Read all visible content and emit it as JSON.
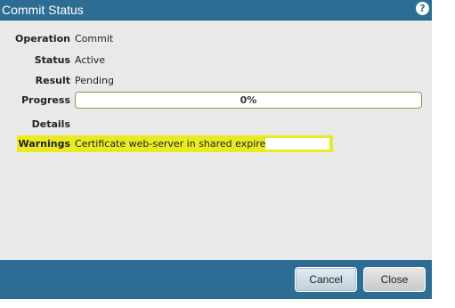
{
  "dialog": {
    "title": "Commit Status",
    "help_icon": "question-mark-icon"
  },
  "fields": {
    "operation": {
      "label": "Operation",
      "value": "Commit"
    },
    "status": {
      "label": "Status",
      "value": "Active"
    },
    "result": {
      "label": "Result",
      "value": "Pending"
    },
    "progress": {
      "label": "Progress",
      "value_text": "0%",
      "fraction": 0
    },
    "details": {
      "label": "Details",
      "value": ""
    },
    "warnings": {
      "label": "Warnings",
      "value": "Certificate web-server in shared expired on"
    }
  },
  "footer": {
    "cancel_label": "Cancel",
    "close_label": "Close"
  },
  "colors": {
    "titlebar": "#2e6d93",
    "background": "#e9e9e9",
    "highlight": "#eaea24",
    "progress_border": "#a8894a"
  }
}
